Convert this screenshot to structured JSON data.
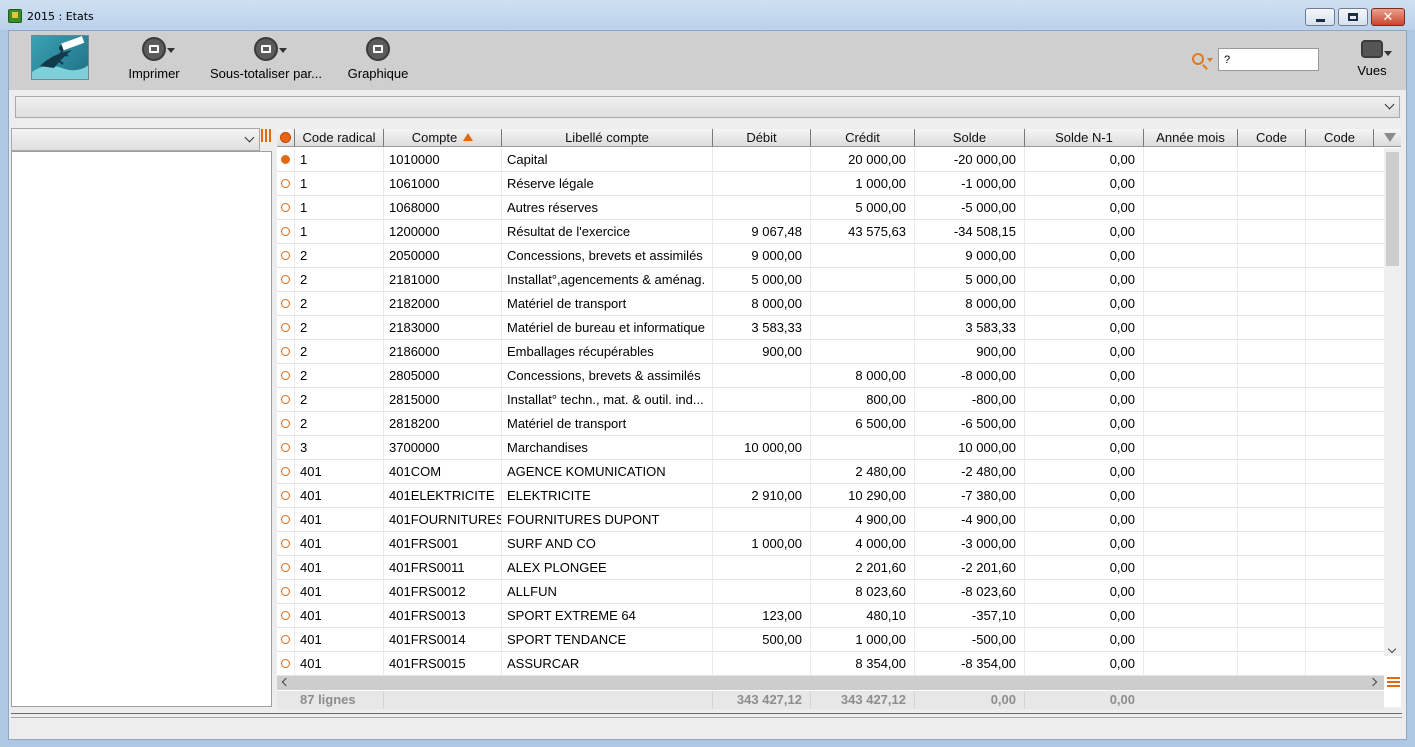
{
  "window": {
    "title": "2015 : Etats",
    "close_label": "✕"
  },
  "toolbar": {
    "print_label": "Imprimer",
    "subtotal_label": "Sous-totaliser par...",
    "chart_label": "Graphique",
    "views_label": "Vues",
    "search_value": "?"
  },
  "grid": {
    "columns": [
      "Code radical",
      "Compte",
      "Libellé compte",
      "Débit",
      "Crédit",
      "Solde",
      "Solde N-1",
      "Année mois",
      "Code",
      "Code"
    ],
    "sorted_column": "Compte",
    "rows": [
      {
        "radical": "1",
        "compte": "1010000",
        "libelle": "Capital",
        "debit": "",
        "credit": "20 000,00",
        "solde": "-20 000,00",
        "solde_n1": "0,00",
        "selected": true
      },
      {
        "radical": "1",
        "compte": "1061000",
        "libelle": "Réserve légale",
        "debit": "",
        "credit": "1 000,00",
        "solde": "-1 000,00",
        "solde_n1": "0,00"
      },
      {
        "radical": "1",
        "compte": "1068000",
        "libelle": "Autres réserves",
        "debit": "",
        "credit": "5 000,00",
        "solde": "-5 000,00",
        "solde_n1": "0,00"
      },
      {
        "radical": "1",
        "compte": "1200000",
        "libelle": "Résultat de l'exercice",
        "debit": "9 067,48",
        "credit": "43 575,63",
        "solde": "-34 508,15",
        "solde_n1": "0,00"
      },
      {
        "radical": "2",
        "compte": "2050000",
        "libelle": "Concessions, brevets et assimilés",
        "debit": "9 000,00",
        "credit": "",
        "solde": "9 000,00",
        "solde_n1": "0,00"
      },
      {
        "radical": "2",
        "compte": "2181000",
        "libelle": "Installat°,agencements & aménag.",
        "debit": "5 000,00",
        "credit": "",
        "solde": "5 000,00",
        "solde_n1": "0,00"
      },
      {
        "radical": "2",
        "compte": "2182000",
        "libelle": "Matériel de transport",
        "debit": "8 000,00",
        "credit": "",
        "solde": "8 000,00",
        "solde_n1": "0,00"
      },
      {
        "radical": "2",
        "compte": "2183000",
        "libelle": "Matériel de bureau et informatique",
        "debit": "3 583,33",
        "credit": "",
        "solde": "3 583,33",
        "solde_n1": "0,00"
      },
      {
        "radical": "2",
        "compte": "2186000",
        "libelle": "Emballages récupérables",
        "debit": "900,00",
        "credit": "",
        "solde": "900,00",
        "solde_n1": "0,00"
      },
      {
        "radical": "2",
        "compte": "2805000",
        "libelle": "Concessions, brevets & assimilés",
        "debit": "",
        "credit": "8 000,00",
        "solde": "-8 000,00",
        "solde_n1": "0,00"
      },
      {
        "radical": "2",
        "compte": "2815000",
        "libelle": "Installat° techn., mat. & outil. ind...",
        "debit": "",
        "credit": "800,00",
        "solde": "-800,00",
        "solde_n1": "0,00"
      },
      {
        "radical": "2",
        "compte": "2818200",
        "libelle": "Matériel de transport",
        "debit": "",
        "credit": "6 500,00",
        "solde": "-6 500,00",
        "solde_n1": "0,00"
      },
      {
        "radical": "3",
        "compte": "3700000",
        "libelle": "Marchandises",
        "debit": "10 000,00",
        "credit": "",
        "solde": "10 000,00",
        "solde_n1": "0,00"
      },
      {
        "radical": "401",
        "compte": "401COM",
        "libelle": "AGENCE KOMUNICATION",
        "debit": "",
        "credit": "2 480,00",
        "solde": "-2 480,00",
        "solde_n1": "0,00"
      },
      {
        "radical": "401",
        "compte": "401ELEKTRICITE",
        "libelle": "ELEKTRICITE",
        "debit": "2 910,00",
        "credit": "10 290,00",
        "solde": "-7 380,00",
        "solde_n1": "0,00"
      },
      {
        "radical": "401",
        "compte": "401FOURNITURES",
        "libelle": "FOURNITURES DUPONT",
        "debit": "",
        "credit": "4 900,00",
        "solde": "-4 900,00",
        "solde_n1": "0,00"
      },
      {
        "radical": "401",
        "compte": "401FRS001",
        "libelle": "SURF AND CO",
        "debit": "1 000,00",
        "credit": "4 000,00",
        "solde": "-3 000,00",
        "solde_n1": "0,00"
      },
      {
        "radical": "401",
        "compte": "401FRS0011",
        "libelle": "ALEX PLONGEE",
        "debit": "",
        "credit": "2 201,60",
        "solde": "-2 201,60",
        "solde_n1": "0,00"
      },
      {
        "radical": "401",
        "compte": "401FRS0012",
        "libelle": "ALLFUN",
        "debit": "",
        "credit": "8 023,60",
        "solde": "-8 023,60",
        "solde_n1": "0,00"
      },
      {
        "radical": "401",
        "compte": "401FRS0013",
        "libelle": "SPORT EXTREME 64",
        "debit": "123,00",
        "credit": "480,10",
        "solde": "-357,10",
        "solde_n1": "0,00"
      },
      {
        "radical": "401",
        "compte": "401FRS0014",
        "libelle": "SPORT TENDANCE",
        "debit": "500,00",
        "credit": "1 000,00",
        "solde": "-500,00",
        "solde_n1": "0,00"
      },
      {
        "radical": "401",
        "compte": "401FRS0015",
        "libelle": "ASSURCAR",
        "debit": "",
        "credit": "8 354,00",
        "solde": "-8 354,00",
        "solde_n1": "0,00"
      }
    ],
    "totals": {
      "lines": "87 lignes",
      "debit": "343 427,12",
      "credit": "343 427,12",
      "solde": "0,00",
      "solde_n1": "0,00"
    }
  },
  "colors": {
    "accent": "#e06a12",
    "toolbar_bg": "#cfcfcf",
    "titlebar": "#b9d1ea"
  }
}
